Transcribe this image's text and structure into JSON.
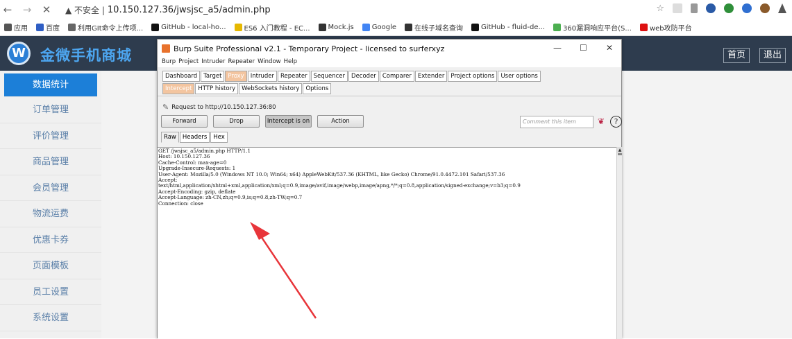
{
  "browser": {
    "back": "←",
    "forward": "→",
    "close": "✕",
    "security_label": "▲ 不安全 |",
    "url": "10.150.127.36/jwsjsc_a5/admin.php",
    "star": "☆",
    "bookmarks": [
      {
        "label": "应用",
        "color": "#555"
      },
      {
        "label": "百度",
        "color": "#2f5ec4"
      },
      {
        "label": "利用GIt命令上传项...",
        "color": "#666"
      },
      {
        "label": "GitHub - local-ho...",
        "color": "#111"
      },
      {
        "label": "ES6 入门教程 - EC...",
        "color": "#e6b800"
      },
      {
        "label": "Mock.js",
        "color": "#333"
      },
      {
        "label": "Google",
        "color": "#4285f4"
      },
      {
        "label": "在线子域名查询",
        "color": "#333"
      },
      {
        "label": "GitHub - fluid-de...",
        "color": "#111"
      },
      {
        "label": "360漏洞响应平台(S...",
        "color": "#4caf50"
      },
      {
        "label": "web攻防平台",
        "color": "#d11"
      }
    ]
  },
  "site": {
    "logo_letter": "W",
    "title": "金微手机商城",
    "home_button": "首页",
    "logout_button": "退出",
    "menu": [
      "数据统计",
      "订单管理",
      "评价管理",
      "商品管理",
      "会员管理",
      "物流运费",
      "优惠卡券",
      "页面模板",
      "员工设置",
      "系统设置"
    ]
  },
  "burp": {
    "title": "Burp Suite Professional v2.1 - Temporary Project - licensed to surferxyz",
    "minimize": "—",
    "maximize": "☐",
    "close": "✕",
    "menus": [
      "Burp",
      "Project",
      "Intruder",
      "Repeater",
      "Window",
      "Help"
    ],
    "main_tabs": [
      "Dashboard",
      "Target",
      "Proxy",
      "Intruder",
      "Repeater",
      "Sequencer",
      "Decoder",
      "Comparer",
      "Extender",
      "Project options",
      "User options"
    ],
    "proxy_tabs": [
      "Intercept",
      "HTTP history",
      "WebSockets history",
      "Options"
    ],
    "request_to": "Request to http://10.150.127.36:80",
    "buttons": {
      "forward": "Forward",
      "drop": "Drop",
      "intercept": "Intercept is on",
      "action": "Action"
    },
    "comment_placeholder": "Comment this item",
    "help": "?",
    "view_tabs": [
      "Raw",
      "Headers",
      "Hex"
    ],
    "request_lines": [
      "GET /jwsjsc_a5/admin.php HTTP/1.1",
      "Host: 10.150.127.36",
      "Cache-Control: max-age=0",
      "Upgrade-Insecure-Requests: 1",
      "User-Agent: Mozilla/5.0 (Windows NT 10.0; Win64; x64) AppleWebKit/537.36 (KHTML, like Gecko) Chrome/91.0.4472.101 Safari/537.36",
      "Accept:",
      "text/html,application/xhtml+xml,application/xml;q=0.9,image/avif,image/webp,image/apng,*/*;q=0.8,application/signed-exchange;v=b3;q=0.9",
      "Accept-Encoding: gzip, deflate",
      "Accept-Language: zh-CN,zh;q=0.9,is;q=0.8,zh-TW;q=0.7",
      "Connection: close"
    ]
  },
  "colors": {
    "header_bg": "#2e3c4e",
    "title_blue": "#4da6f0",
    "active_menu": "#1c7fd8",
    "proxy_tab": "#f3c5a0",
    "arrow_red": "#e8353a"
  }
}
